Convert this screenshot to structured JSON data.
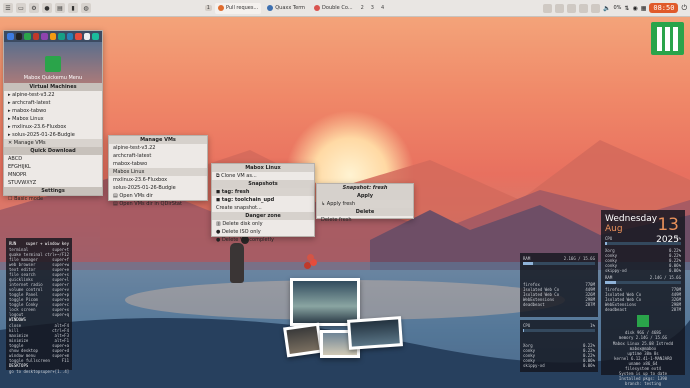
{
  "topbar": {
    "workspace_active": "1",
    "workspaces": [
      "2",
      "3",
      "4"
    ],
    "tasks": [
      {
        "label": "Pull reques...",
        "dot": "#e06c2d"
      },
      {
        "label": "Quaxx Term",
        "dot": "#3c6fb0"
      },
      {
        "label": "Double Co...",
        "dot": "#d9534f"
      }
    ],
    "volume": "0%",
    "clock": "08:50"
  },
  "mainmenu": {
    "title": "Mabox Quickemu Menu",
    "virtual_machines_header": "Virtual Machines",
    "vms": [
      "alpine-test-v3.22",
      "archcraft-latest",
      "mabox-tabwo",
      "Mabox Linux",
      "mxlinux-23.6-Fluxbox",
      "solus-2025-01-26-Budgie"
    ],
    "manage_vms": "Manage VMs",
    "quick_download_header": "Quick Download",
    "downloads": [
      "ABCD",
      "EFGHIJKL",
      "MNOPR",
      "STUVWXYZ"
    ],
    "settings_header": "Settings",
    "basic_mode": "Basic mode"
  },
  "vmsmenu": {
    "title": "Manage VMs",
    "items": [
      "alpine-test-v3.22",
      "archcraft-latest",
      "mabox-tabwo",
      "Mabox Linux",
      "mxlinux-23.6-Fluxbox",
      "solus-2025-01-26-Budgie"
    ],
    "open_dir": "Open VMs dir",
    "open_dir_qdir": "Open VMs dir in QDirStat"
  },
  "mboxmenu": {
    "title": "Mabox Linux",
    "clone": "Clone VM as...",
    "snapshots_header": "Snapshots",
    "snapshots": [
      "tag: fresh",
      "tag: toolchain_upd"
    ],
    "create_snapshot": "Create snapshot...",
    "danger_header": "Danger zone",
    "danger": [
      "Delete disk only",
      "Delete ISO only",
      "Delete VM completly"
    ]
  },
  "snapmenu": {
    "title": "Snapshot: fresh",
    "apply_header": "Apply",
    "apply": "Apply fresh",
    "delete_header": "Delete",
    "delete": "Delete fresh"
  },
  "keys": {
    "run_header": "RUN",
    "run_header_key": "super + window key",
    "run": [
      [
        "terminal",
        "super+t"
      ],
      [
        "quake terminal",
        "ctrl+~/F12"
      ],
      [
        "file manager",
        "super+f"
      ],
      [
        "web browser",
        "super+w"
      ],
      [
        "text editor",
        "super+e"
      ],
      [
        "file search",
        "super+s"
      ],
      [
        "quicklinks",
        "super+l"
      ],
      [
        "internet radio",
        "super+r"
      ],
      [
        "volume control",
        "super+v"
      ],
      [
        "toggle Panel",
        "super+p"
      ],
      [
        "toggle Picom",
        "super+o"
      ],
      [
        "toggle Conky",
        "super+c"
      ],
      [
        "lock screen",
        "super+x"
      ],
      [
        "logout",
        "super+q"
      ]
    ],
    "windows_header": "WINDOWS",
    "windows": [
      [
        "close",
        "alt+F4"
      ],
      [
        "kill",
        "ctrl+F4"
      ],
      [
        "maximize",
        "alt+F3"
      ],
      [
        "minimize",
        "alt+F1"
      ],
      [
        "toggle",
        "super+a"
      ],
      [
        "show desktop",
        "super+d"
      ],
      [
        "window menu",
        "super+m"
      ],
      [
        "toggle fullscreen",
        "F11"
      ]
    ],
    "desktops_header": "DESKTOPS",
    "desktops": [
      [
        "go to desktop",
        "super+[1..4]"
      ]
    ]
  },
  "ram": {
    "label": "RAM",
    "usage": "2.16G / 15.6G",
    "usage_fraction": 0.14,
    "procs": [
      [
        "firefox",
        "770M"
      ],
      [
        "Isolated Web Co",
        "449M"
      ],
      [
        "Isolated Web Co",
        "326M"
      ],
      [
        "WebExtensions",
        "298M"
      ],
      [
        "deadbeast",
        "287M"
      ]
    ]
  },
  "cpu": {
    "label": "CPU",
    "usage": "1%",
    "usage_fraction": 0.01,
    "procs": [
      [
        "Xorg",
        "0.22%"
      ],
      [
        "conky",
        "0.22%"
      ],
      [
        "conky",
        "0.22%"
      ],
      [
        "conky",
        "0.06%"
      ],
      [
        "skippy-xd",
        "0.06%"
      ]
    ]
  },
  "calendar": {
    "day": "Wednesday",
    "date": "13",
    "month": "Aug",
    "year": "2025",
    "cpu_label": "CPU",
    "cpu_value": "1%",
    "cpu_fraction": 0.01,
    "cpu_procs": [
      [
        "Xorg",
        "0.22%"
      ],
      [
        "conky",
        "0.22%"
      ],
      [
        "conky",
        "0.22%"
      ],
      [
        "conky",
        "0.06%"
      ],
      [
        "skippy-xd",
        "0.06%"
      ]
    ],
    "ram_label": "RAM",
    "ram_value": "2.14G / 15.6G",
    "ram_fraction": 0.14,
    "ram_procs": [
      [
        "firefox",
        "770M"
      ],
      [
        "Isolated Web Co",
        "449M"
      ],
      [
        "Isolated Web Co",
        "326M"
      ],
      [
        "WebExtensions",
        "298M"
      ],
      [
        "deadbeast",
        "287M"
      ]
    ],
    "disk": "disk  96G / 468G",
    "memory": "memory  2.14G / 15.6G",
    "sys": [
      "Mabox Linux 25.08 Istredd",
      "mabox@mabox",
      "uptime 38m 8s",
      "kernel 6.12.41-1-MANJARO",
      "uname x86_64",
      "filesystem ext4",
      "System is up to date",
      "Installed pkgs: 1390",
      "branch: testing"
    ]
  }
}
